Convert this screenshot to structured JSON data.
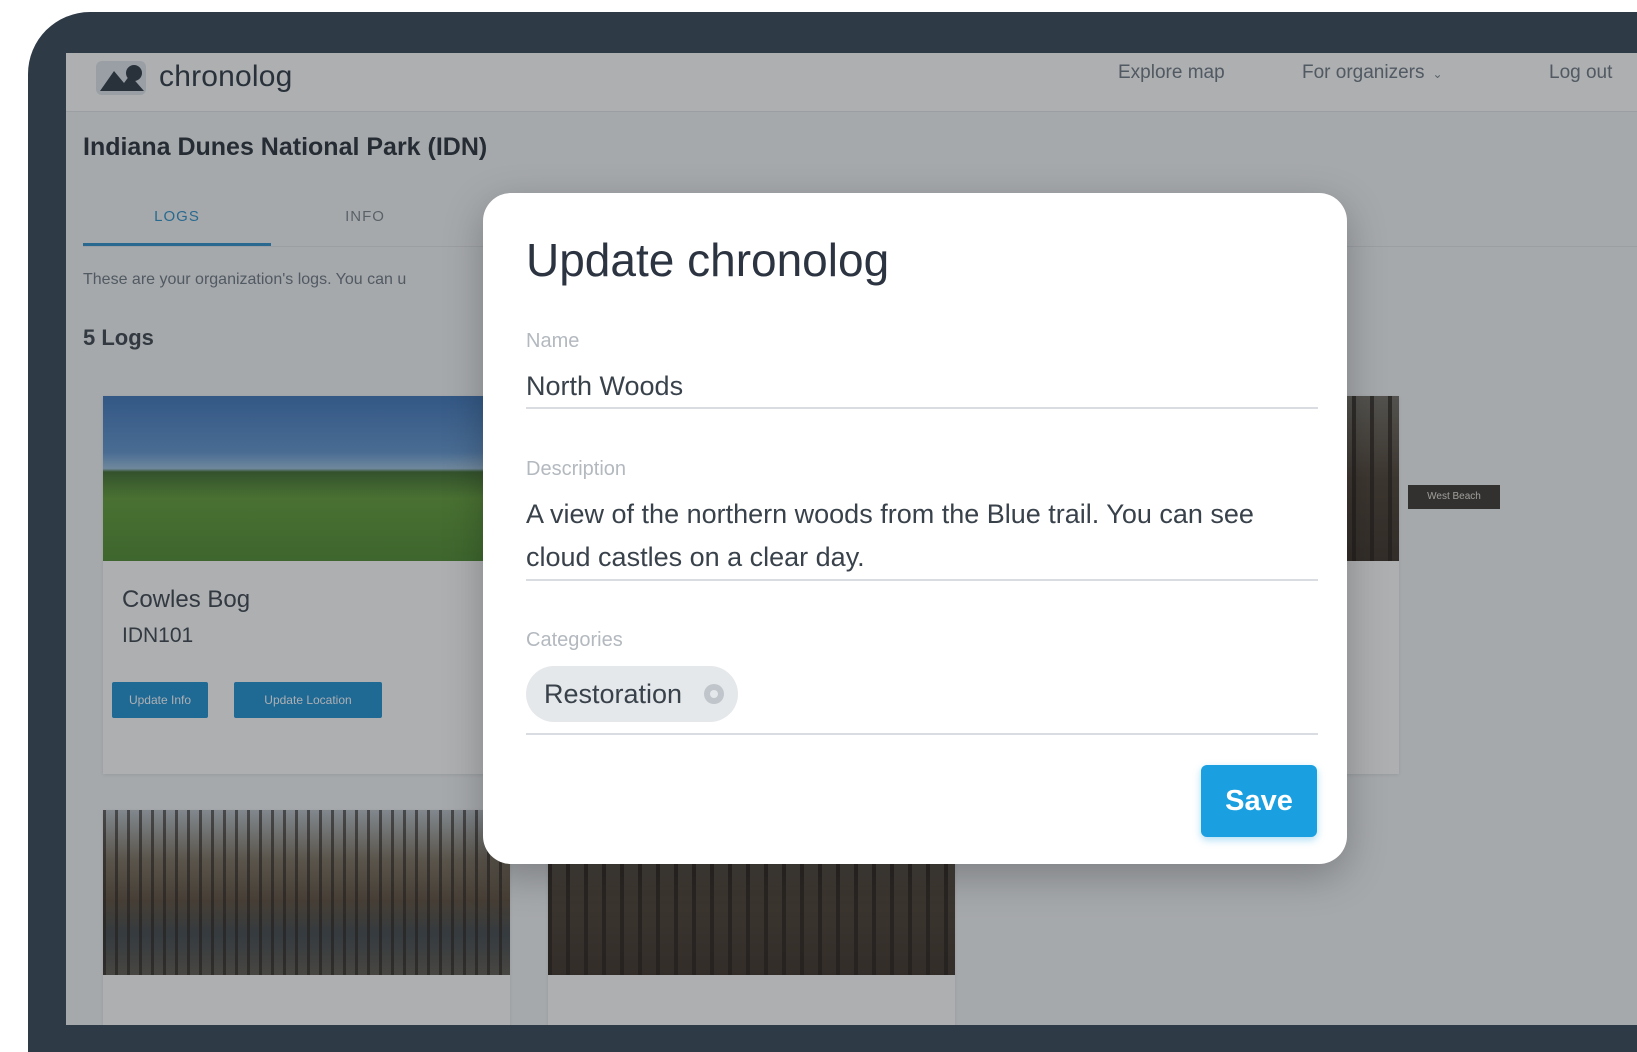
{
  "brand": {
    "name": "chronolog"
  },
  "nav": {
    "explore_map": "Explore map",
    "for_organizers": "For organizers",
    "log_out": "Log out"
  },
  "page": {
    "park_title": "Indiana Dunes National Park (IDN)",
    "tabs": [
      {
        "label": "LOGS",
        "active": true
      },
      {
        "label": "INFO",
        "active": false
      }
    ],
    "intro_text": "These are your organization's logs. You can u",
    "log_count": "5 Logs"
  },
  "cards": [
    {
      "name": "Cowles Bog",
      "code": "IDN101",
      "buttons": {
        "update_info": "Update Info",
        "update_location": "Update Location"
      }
    }
  ],
  "image_tag": "West Beach",
  "modal": {
    "title": "Update chronolog",
    "name_label": "Name",
    "name_value": "North Woods",
    "description_label": "Description",
    "description_value": "A view of the northern woods from the Blue trail. You can see cloud castles on a clear day.",
    "categories_label": "Categories",
    "categories": [
      "Restoration"
    ],
    "save_label": "Save"
  },
  "colors": {
    "accent": "#1aa0e0",
    "frame": "#2f3a47",
    "tab_active": "#2a8fc9"
  }
}
